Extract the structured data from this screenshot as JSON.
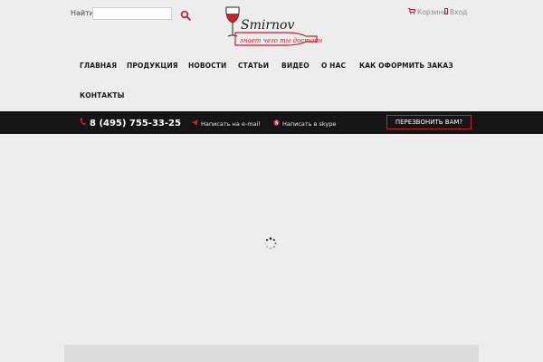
{
  "header": {
    "search": {
      "label": "Найти:",
      "value": "",
      "placeholder": ""
    },
    "logo": {
      "name": "Smirnov",
      "tagline": "знает чего ты достоин"
    },
    "cart_label": "Корзина",
    "login_label": "Вход"
  },
  "nav": {
    "items": [
      {
        "label": "ГЛАВНАЯ"
      },
      {
        "label": "ПРОДУКЦИЯ"
      },
      {
        "label": "НОВОСТИ"
      },
      {
        "label": "СТАТЬИ"
      },
      {
        "label": "ВИДЕО"
      },
      {
        "label": "О НАС"
      },
      {
        "label": "КАК ОФОРМИТЬ ЗАКАЗ"
      },
      {
        "label": "КОНТАКТЫ"
      }
    ]
  },
  "contact_bar": {
    "phone": "8 (495) 755-33-25",
    "email_link": "Написать на e-mail",
    "skype_link": "Написать в skype",
    "callback_button": "ПЕРЕЗВОНИТЬ ВАМ?"
  },
  "colors": {
    "accent": "#c4242c",
    "bar": "#151515",
    "background": "#ededed"
  },
  "icons": [
    "search-icon",
    "cart-icon",
    "login-icon",
    "phone-icon",
    "send-icon",
    "skype-icon",
    "loading-spinner-icon"
  ]
}
